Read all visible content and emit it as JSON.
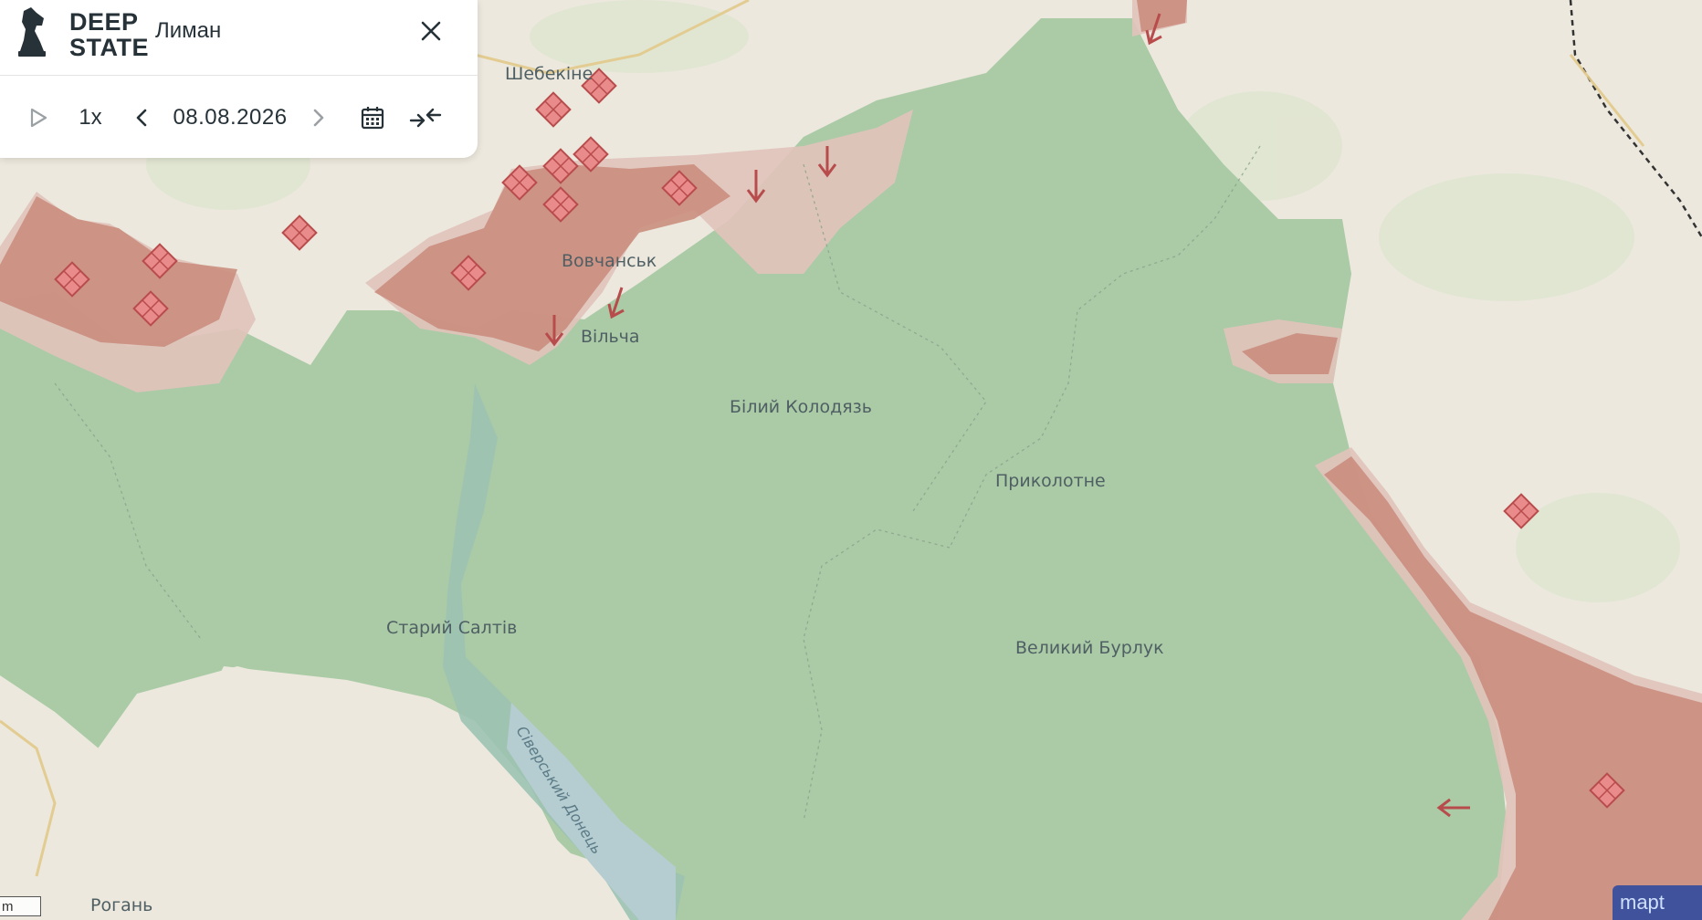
{
  "app": {
    "logo_line1": "DEEP",
    "logo_line2": "STATE",
    "title": "Лиман"
  },
  "timeline": {
    "speed": "1x",
    "date": "08.08.2026"
  },
  "icons": [
    "play-icon",
    "chevron-left-icon",
    "chevron-right-icon",
    "calendar-icon",
    "collapse-icon",
    "close-icon",
    "knight-logo-icon"
  ],
  "colors": {
    "liberated": "#a8ccA6",
    "occupied": "#c9897a",
    "contested": "#e2c8c1",
    "background": "#ece8dd"
  },
  "places": {
    "shebekino": "Шебекіне",
    "vovchansk": "Вовчанськ",
    "vilcha": "Вільча",
    "bilyi_kolodiaz": "Білий Колодязь",
    "prykolotne": "Приколотне",
    "staryi_saltiv": "Старий Салтів",
    "velykyi_burluk": "Великий Бурлук",
    "rohan": "Рогань",
    "river": "Сіверський Донець"
  },
  "map_footer": {
    "scale_label": "m",
    "attribution": "mapt"
  }
}
